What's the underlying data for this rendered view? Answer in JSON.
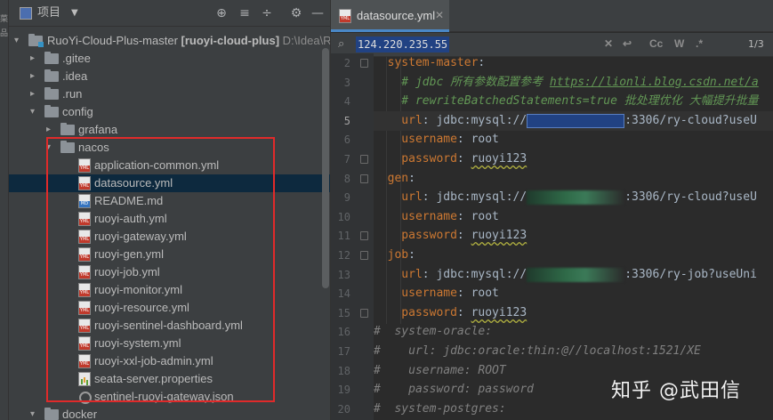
{
  "left_strip_chars": [
    "菜",
    "品"
  ],
  "project_panel": {
    "title": "项目",
    "tree": [
      {
        "label": "RuoYi-Cloud-Plus-master",
        "module": "[ruoyi-cloud-plus]",
        "path": "D:\\Idea\\R",
        "type": "module",
        "depth": 0,
        "open": true
      },
      {
        "label": ".gitee",
        "type": "folder",
        "depth": 1,
        "open": false
      },
      {
        "label": ".idea",
        "type": "folder",
        "depth": 1,
        "open": false
      },
      {
        "label": ".run",
        "type": "folder",
        "depth": 1,
        "open": false
      },
      {
        "label": "config",
        "type": "folder",
        "depth": 1,
        "open": true
      },
      {
        "label": "grafana",
        "type": "folder",
        "depth": 2,
        "open": false
      },
      {
        "label": "nacos",
        "type": "folder",
        "depth": 2,
        "open": true
      },
      {
        "label": "application-common.yml",
        "type": "yml",
        "depth": 3
      },
      {
        "label": "datasource.yml",
        "type": "yml",
        "depth": 3,
        "selected": true
      },
      {
        "label": "README.md",
        "type": "md",
        "depth": 3
      },
      {
        "label": "ruoyi-auth.yml",
        "type": "yml",
        "depth": 3
      },
      {
        "label": "ruoyi-gateway.yml",
        "type": "yml",
        "depth": 3
      },
      {
        "label": "ruoyi-gen.yml",
        "type": "yml",
        "depth": 3
      },
      {
        "label": "ruoyi-job.yml",
        "type": "yml",
        "depth": 3
      },
      {
        "label": "ruoyi-monitor.yml",
        "type": "yml",
        "depth": 3
      },
      {
        "label": "ruoyi-resource.yml",
        "type": "yml",
        "depth": 3
      },
      {
        "label": "ruoyi-sentinel-dashboard.yml",
        "type": "yml",
        "depth": 3
      },
      {
        "label": "ruoyi-system.yml",
        "type": "yml",
        "depth": 3
      },
      {
        "label": "ruoyi-xxl-job-admin.yml",
        "type": "yml",
        "depth": 3
      },
      {
        "label": "seata-server.properties",
        "type": "properties",
        "depth": 3
      },
      {
        "label": "sentinel-ruoyi-gateway.json",
        "type": "json",
        "depth": 3
      },
      {
        "label": "docker",
        "type": "folder",
        "depth": 1,
        "open": true
      }
    ]
  },
  "editor": {
    "tab_label": "datasource.yml",
    "find": {
      "query": "124.220.235.55",
      "match_count": "1/3",
      "cc_label": "Cc",
      "w_label": "W"
    },
    "lines": [
      {
        "n": "2",
        "segs": [
          {
            "c": "key",
            "t": "  system-master"
          },
          {
            "c": "val",
            "t": ":"
          }
        ]
      },
      {
        "n": "3",
        "segs": [
          {
            "c": "cmt",
            "t": "    # jdbc 所有参数配置参考 "
          },
          {
            "c": "link",
            "t": "https://lionli.blog.csdn.net/a"
          }
        ]
      },
      {
        "n": "4",
        "segs": [
          {
            "c": "cmt",
            "t": "    # rewriteBatchedStatements=true 批处理优化 大幅提升批量"
          }
        ]
      },
      {
        "n": "5",
        "caret": true,
        "segs": [
          {
            "c": "key",
            "t": "    url"
          },
          {
            "c": "val",
            "t": ": jdbc:mysql://"
          },
          {
            "c": "blur hl",
            "t": ""
          },
          {
            "c": "val",
            "t": ":3306/ry-cloud?useU"
          }
        ]
      },
      {
        "n": "6",
        "segs": [
          {
            "c": "key",
            "t": "    username"
          },
          {
            "c": "val",
            "t": ": root"
          }
        ]
      },
      {
        "n": "7",
        "segs": [
          {
            "c": "key",
            "t": "    password"
          },
          {
            "c": "val",
            "t": ": "
          },
          {
            "c": "val squig",
            "t": "ruoyi123"
          }
        ]
      },
      {
        "n": "8",
        "segs": [
          {
            "c": "key",
            "t": "  gen"
          },
          {
            "c": "val",
            "t": ":"
          }
        ]
      },
      {
        "n": "9",
        "segs": [
          {
            "c": "key",
            "t": "    url"
          },
          {
            "c": "val",
            "t": ": jdbc:mysql://"
          },
          {
            "c": "blur",
            "t": ""
          },
          {
            "c": "val",
            "t": ":3306/ry-cloud?useU"
          }
        ]
      },
      {
        "n": "10",
        "segs": [
          {
            "c": "key",
            "t": "    username"
          },
          {
            "c": "val",
            "t": ": root"
          }
        ]
      },
      {
        "n": "11",
        "segs": [
          {
            "c": "key",
            "t": "    password"
          },
          {
            "c": "val",
            "t": ": "
          },
          {
            "c": "val squig",
            "t": "ruoyi123"
          }
        ]
      },
      {
        "n": "12",
        "segs": [
          {
            "c": "key",
            "t": "  job"
          },
          {
            "c": "val",
            "t": ":"
          }
        ]
      },
      {
        "n": "13",
        "segs": [
          {
            "c": "key",
            "t": "    url"
          },
          {
            "c": "val",
            "t": ": jdbc:mysql://"
          },
          {
            "c": "blur",
            "t": ""
          },
          {
            "c": "val",
            "t": ":3306/ry-job?useUni"
          }
        ]
      },
      {
        "n": "14",
        "segs": [
          {
            "c": "key",
            "t": "    username"
          },
          {
            "c": "val",
            "t": ": root"
          }
        ]
      },
      {
        "n": "15",
        "segs": [
          {
            "c": "key",
            "t": "    password"
          },
          {
            "c": "val",
            "t": ": "
          },
          {
            "c": "val squig",
            "t": "ruoyi123"
          }
        ]
      },
      {
        "n": "16",
        "segs": [
          {
            "c": "cmt-dim",
            "t": "#  system-oracle:"
          }
        ]
      },
      {
        "n": "17",
        "segs": [
          {
            "c": "cmt-dim",
            "t": "#    url: jdbc:oracle:thin:@//localhost:1521/XE"
          }
        ]
      },
      {
        "n": "18",
        "segs": [
          {
            "c": "cmt-dim",
            "t": "#    username: ROOT"
          }
        ]
      },
      {
        "n": "19",
        "segs": [
          {
            "c": "cmt-dim",
            "t": "#    password: password"
          }
        ]
      },
      {
        "n": "20",
        "segs": [
          {
            "c": "cmt-dim",
            "t": "#  system-postgres:"
          }
        ]
      }
    ]
  },
  "watermark": "知乎 @武田信",
  "colors": {
    "panel_bg": "#3c3f41",
    "editor_bg": "#2b2b2b",
    "selection": "#0d293e",
    "highlight_box": "#e02a2a",
    "yaml_key": "#cc7832",
    "comment": "#629755"
  }
}
